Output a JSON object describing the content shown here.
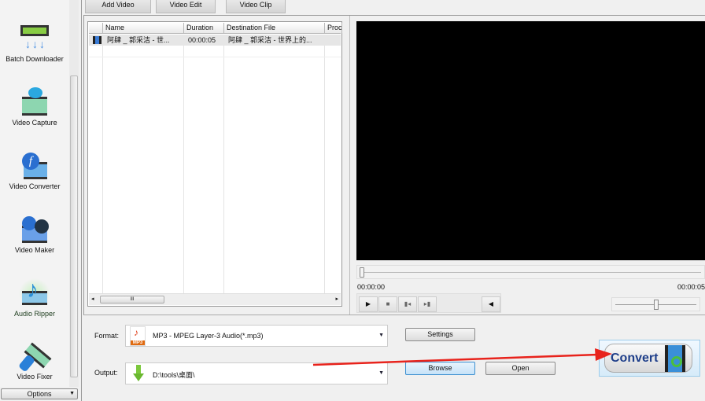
{
  "sidebar": {
    "items": [
      {
        "label": "Batch Downloader",
        "icon": "batch-download-icon"
      },
      {
        "label": "Video Capture",
        "icon": "video-capture-icon"
      },
      {
        "label": "Video Converter",
        "icon": "video-converter-icon"
      },
      {
        "label": "Video Maker",
        "icon": "video-maker-icon"
      },
      {
        "label": "Audio Ripper",
        "icon": "audio-ripper-icon"
      },
      {
        "label": "Video Fixer",
        "icon": "video-fixer-icon"
      }
    ],
    "options_label": "Options"
  },
  "tabs": [
    "Add Video",
    "Video Edit",
    "Video Clip"
  ],
  "file_list": {
    "columns": [
      "Name",
      "Duration",
      "Destination File",
      "Proc"
    ],
    "rows": [
      {
        "name": "阿肆 _ 郭采洁 - 世...",
        "duration": "00:00:05",
        "destination": "阿肆 _ 郭采洁 - 世界上的...",
        "proc": ""
      }
    ],
    "hscroll_grip": "III"
  },
  "player": {
    "current_time": "00:00:00",
    "total_time": "00:00:05",
    "seek_fraction": 0,
    "volume_fraction": 0.5
  },
  "settings": {
    "format_label": "Format:",
    "format_value": "MP3 - MPEG Layer-3 Audio(*.mp3)",
    "format_icon_text": "MP3",
    "output_label": "Output:",
    "output_value": "D:\\tools\\桌面\\",
    "settings_button": "Settings",
    "browse_button": "Browse",
    "open_button": "Open",
    "convert_button": "Convert"
  },
  "colors": {
    "annotation_arrow": "#e8231c",
    "convert_text": "#1f3f8a"
  }
}
